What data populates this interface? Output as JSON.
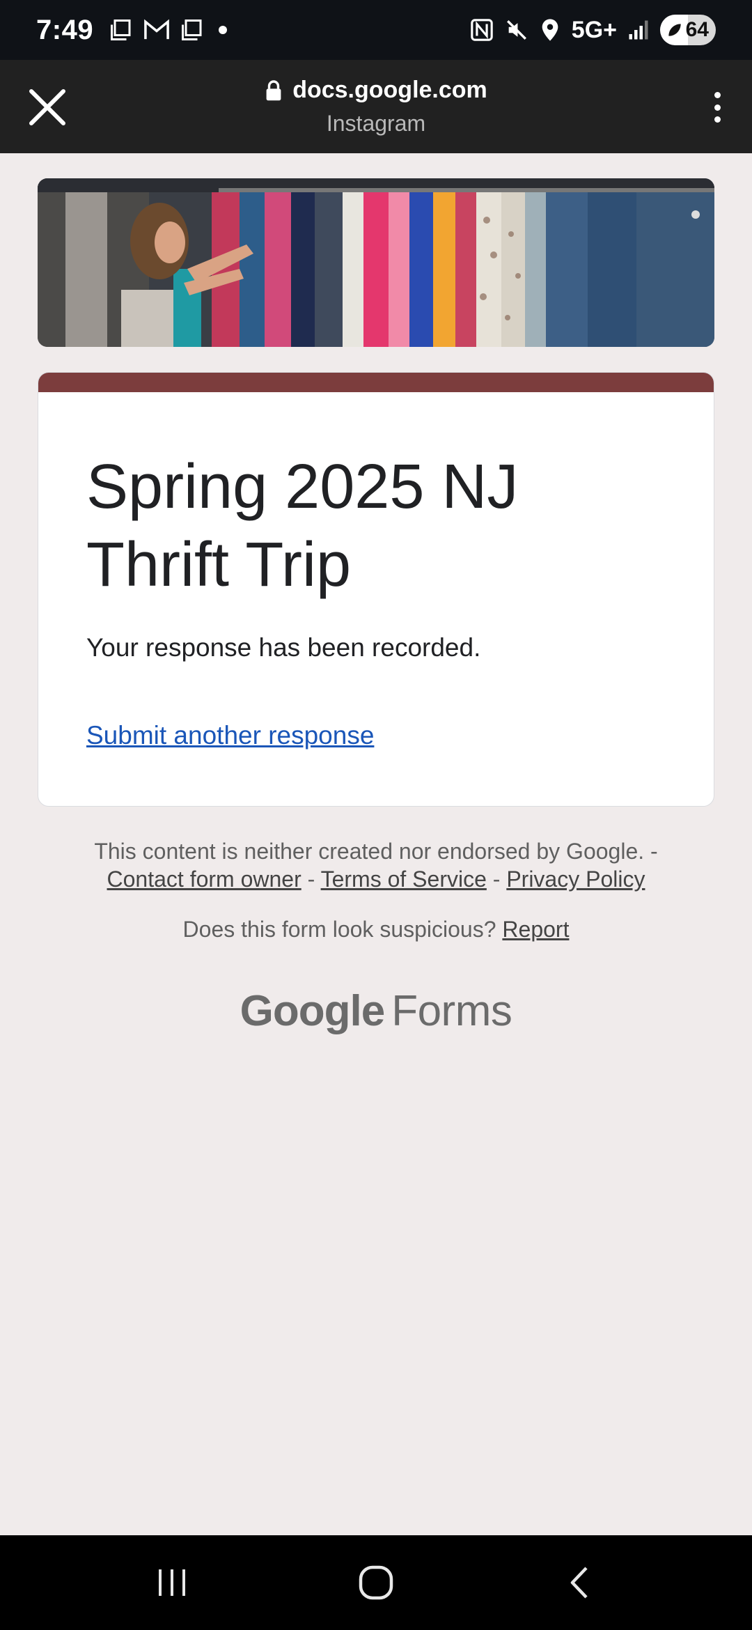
{
  "status_bar": {
    "time": "7:49",
    "network": "5G+",
    "battery": "64",
    "notification_icons": [
      "copy-icon",
      "gmail-icon",
      "copy-icon",
      "dot-icon"
    ],
    "system_icons": [
      "nfc-icon",
      "mute-icon",
      "location-icon",
      "signal-icon",
      "battery-icon"
    ]
  },
  "browser": {
    "domain": "docs.google.com",
    "source": "Instagram"
  },
  "form": {
    "title": "Spring 2025 NJ Thrift Trip",
    "message": "Your response has been recorded.",
    "submit_another": "Submit another response",
    "accent_color": "#7c3d3d"
  },
  "footer": {
    "disclaimer": "This content is neither created nor endorsed by Google. -",
    "contact_owner": "Contact form owner",
    "sep1": "-",
    "terms": "Terms of Service",
    "sep2": "-",
    "privacy": "Privacy Policy",
    "suspicious": "Does this form look suspicious?",
    "report": "Report"
  },
  "brand": {
    "google": "Google",
    "forms": "Forms"
  }
}
